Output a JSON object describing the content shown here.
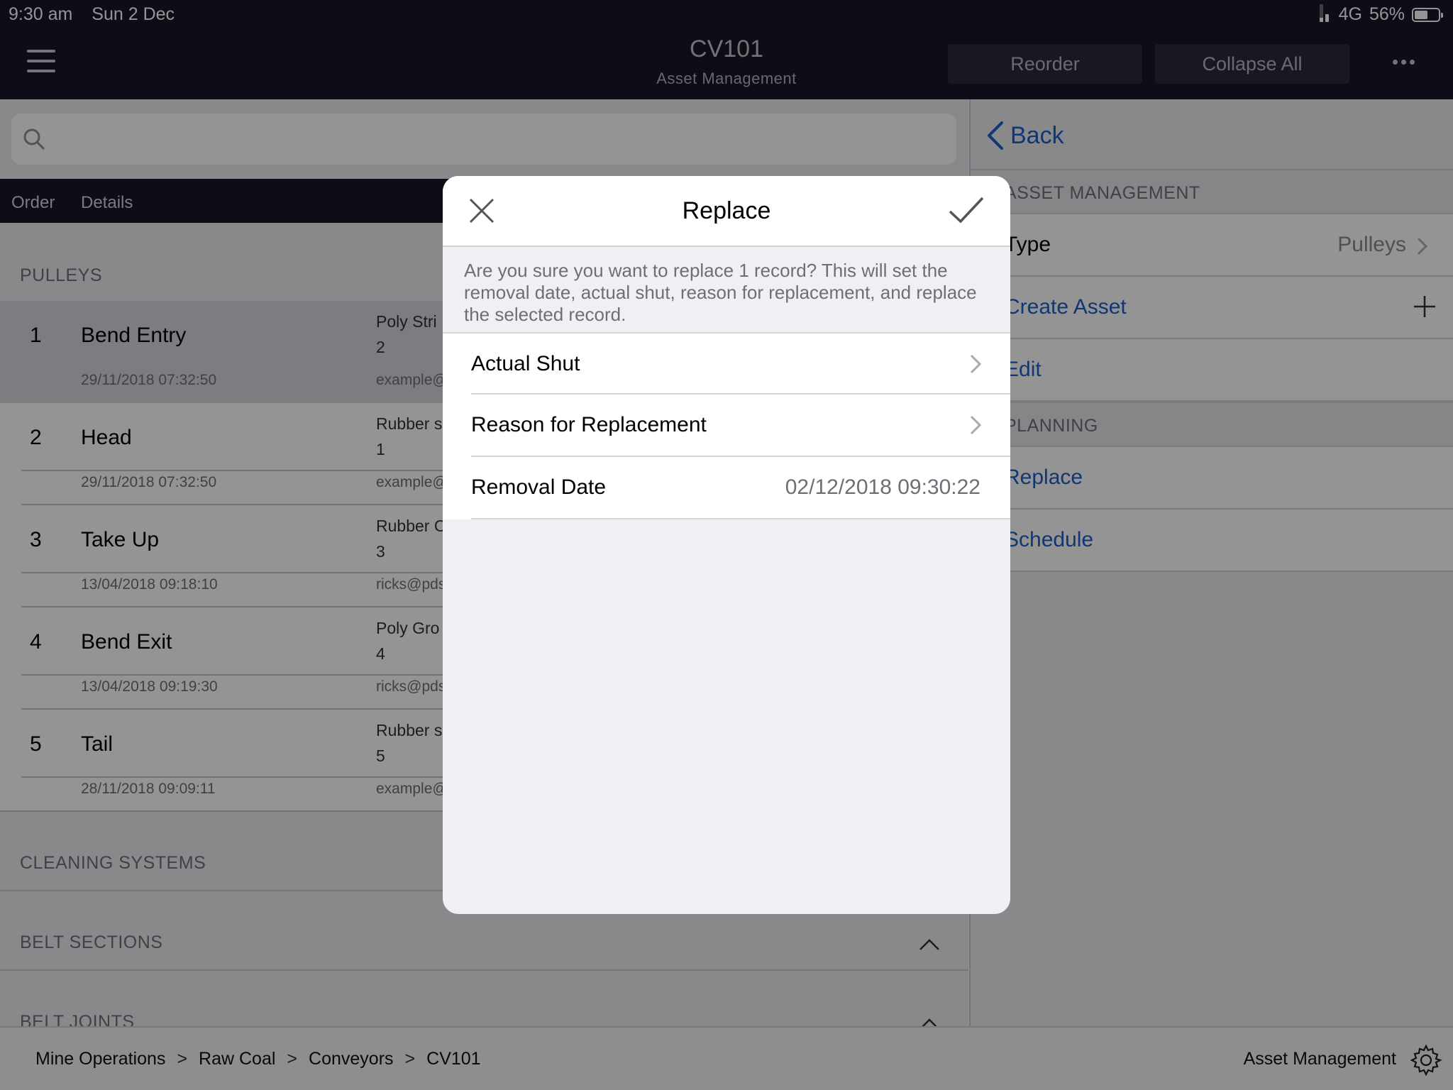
{
  "status_bar": {
    "time": "9:30 am",
    "date": "Sun 2 Dec",
    "network": "4G",
    "battery": "56%",
    "battery_level": 0.56
  },
  "nav": {
    "title": "CV101",
    "subtitle": "Asset Management",
    "reorder_label": "Reorder",
    "collapse_label": "Collapse All"
  },
  "left": {
    "columns": {
      "order": "Order",
      "details": "Details"
    },
    "sections": {
      "pulleys": "PULLEYS",
      "cleaning": "CLEANING SYSTEMS",
      "belt_sections": "BELT SECTIONS",
      "belt_joints": "BELT JOINTS"
    },
    "rows": [
      {
        "num": "1",
        "name": "Bend Entry",
        "date": "29/11/2018 07:32:50",
        "material": "Poly Stri",
        "qty": "2",
        "email": "example@"
      },
      {
        "num": "2",
        "name": "Head",
        "date": "29/11/2018 07:32:50",
        "material": "Rubber s",
        "qty": "1",
        "email": "example@"
      },
      {
        "num": "3",
        "name": "Take Up",
        "date": "13/04/2018 09:18:10",
        "material": "Rubber C",
        "qty": "3",
        "email": "ricks@pds"
      },
      {
        "num": "4",
        "name": "Bend Exit",
        "date": "13/04/2018 09:19:30",
        "material": "Poly Gro",
        "qty": "4",
        "email": "ricks@pds"
      },
      {
        "num": "5",
        "name": "Tail",
        "date": "28/11/2018 09:09:11",
        "material": "Rubber s",
        "qty": "5",
        "email": "example@"
      }
    ]
  },
  "right": {
    "back_label": "Back",
    "asset_mgmt_header": "ASSET MANAGEMENT",
    "type_label": "Type",
    "type_value": "Pulleys",
    "create_asset": "Create Asset",
    "edit": "Edit",
    "planning_header": "PLANNING",
    "replace": "Replace",
    "schedule": "Schedule"
  },
  "modal": {
    "title": "Replace",
    "description": "Are you sure you want to replace 1 record? This will set the removal date, actual shut, reason for replacement, and replace the selected record.",
    "actual_shut": "Actual Shut",
    "reason": "Reason for Replacement",
    "removal_date_label": "Removal Date",
    "removal_date_value": "02/12/2018 09:30:22"
  },
  "bottom_bar": {
    "crumbs": [
      "Mine Operations",
      "Raw Coal",
      "Conveyors",
      "CV101"
    ],
    "separator": ">",
    "module": "Asset Management"
  },
  "colors": {
    "nav_bg": "#171728",
    "link": "#1d5fc8",
    "overlay": "rgba(0,0,0,0.42)"
  },
  "icons": [
    "menu-icon",
    "more-icon",
    "search-icon",
    "back-chevron-icon",
    "plus-icon",
    "chevron-right-icon",
    "chevron-up-icon",
    "close-icon",
    "checkmark-icon",
    "gear-icon",
    "signal-icon",
    "battery-icon"
  ]
}
